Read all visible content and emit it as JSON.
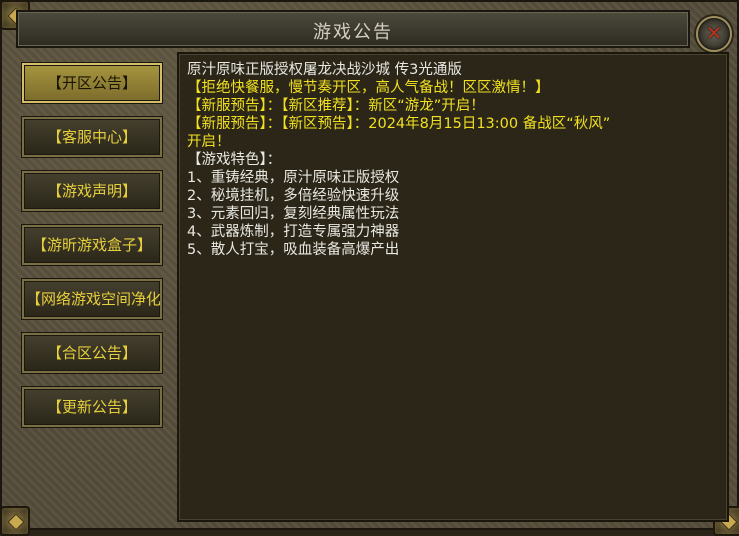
{
  "window": {
    "title": "游戏公告"
  },
  "sidebar": {
    "items": [
      {
        "label": "【开区公告】",
        "active": true
      },
      {
        "label": "【客服中心】",
        "active": false
      },
      {
        "label": "【游戏声明】",
        "active": false
      },
      {
        "label": "【游昕游戏盒子】",
        "active": false
      },
      {
        "label": "【网络游戏空间净化",
        "active": false
      },
      {
        "label": "【合区公告】",
        "active": false
      },
      {
        "label": "【更新公告】",
        "active": false
      }
    ]
  },
  "content": {
    "lines": [
      {
        "text": "原汁原味正版授权屠龙决战沙城 传3光通版",
        "color": "white"
      },
      {
        "text": "【拒绝快餐服，慢节奏开区，高人气备战！区区激情！】",
        "color": "yellow"
      },
      {
        "text": "【新服预告】：【新区推荐】：新区“游龙”开启！",
        "color": "yellow"
      },
      {
        "text": "【新服预告】：【新区预告】：2024年8月15日13:00 备战区“秋风”",
        "color": "yellow"
      },
      {
        "text": "开启！",
        "color": "yellow"
      },
      {
        "text": "【游戏特色】：",
        "color": "white"
      },
      {
        "text": "1、重铸经典，原汁原味正版授权",
        "color": "white"
      },
      {
        "text": "2、秘境挂机，多倍经验快速升级",
        "color": "white"
      },
      {
        "text": "3、元素回归，复刻经典属性玩法",
        "color": "white"
      },
      {
        "text": "4、武器炼制，打造专属强力神器",
        "color": "white"
      },
      {
        "text": "5、散人打宝，吸血装备高爆产出",
        "color": "white"
      }
    ]
  },
  "colors": {
    "accent_yellow": "#f0e020",
    "text_white": "#e8e8e2",
    "close_x": "#b8321e"
  },
  "icons": {
    "close": "close-x-icon"
  }
}
